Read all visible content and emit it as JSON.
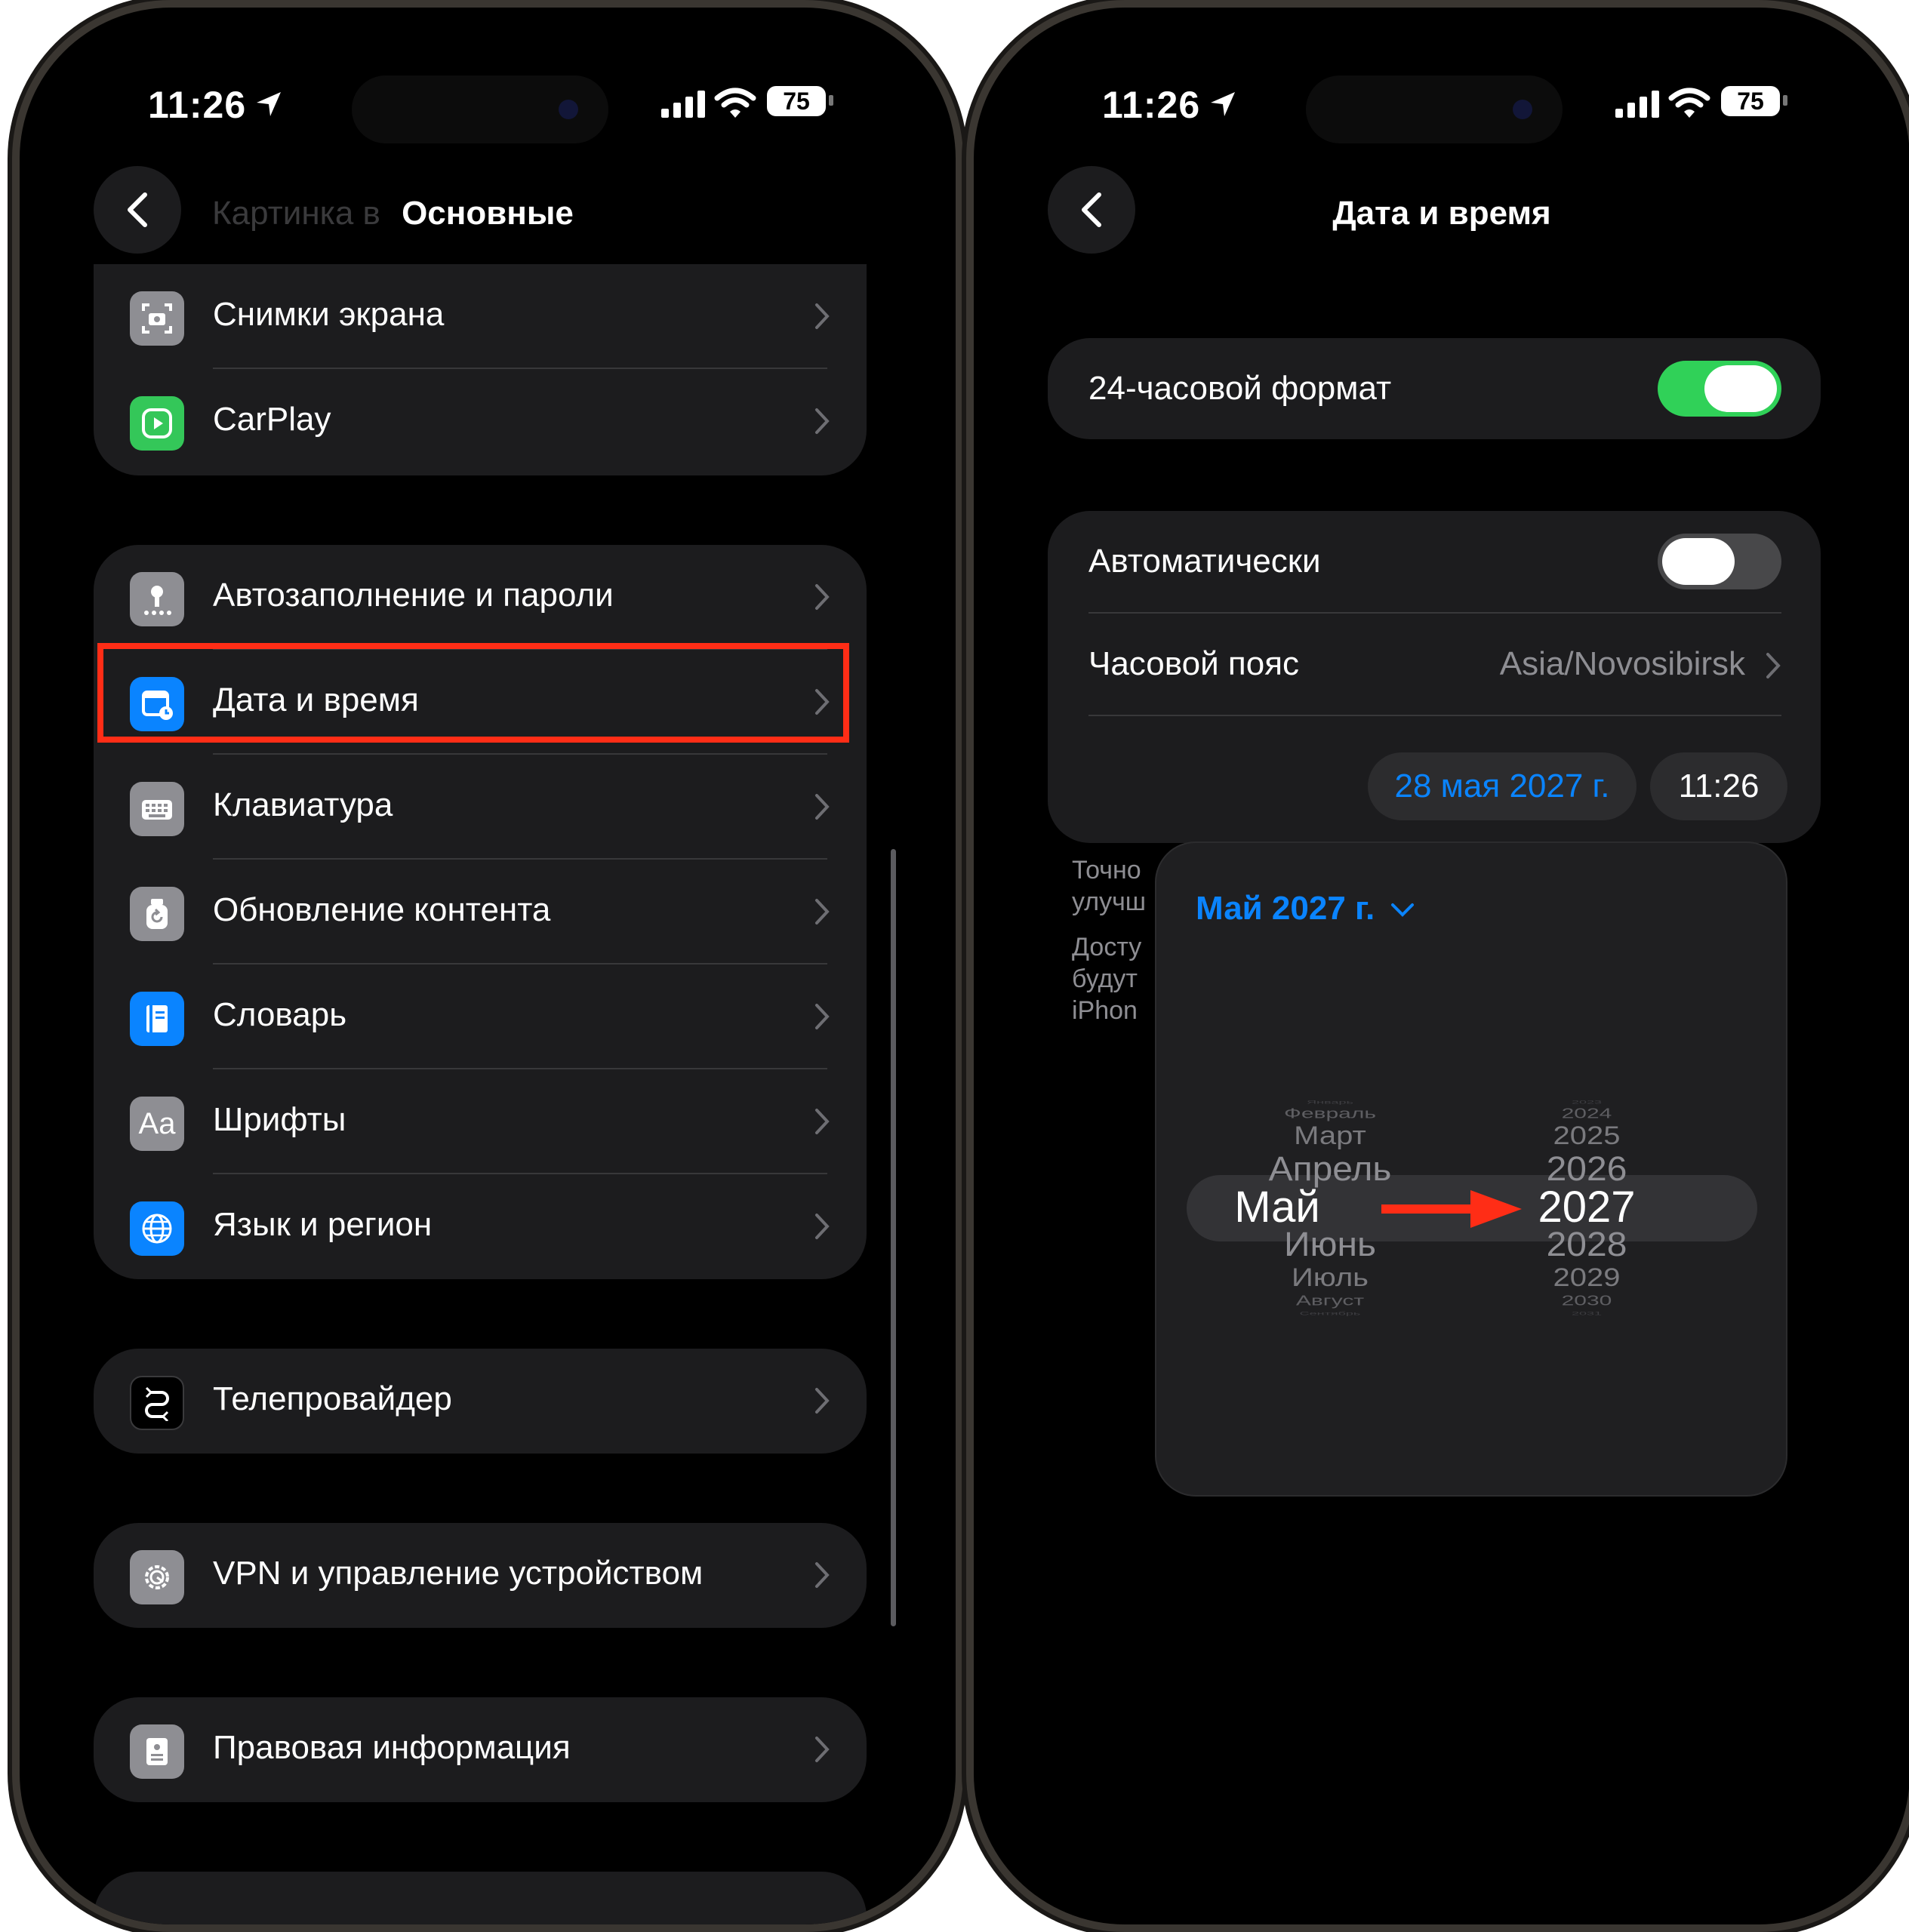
{
  "left_screen": {
    "status": {
      "time": "11:26",
      "battery": "75"
    },
    "nav": {
      "title": "Основные",
      "ghost_label": "Картинка в"
    },
    "groups": [
      {
        "items": [
          {
            "label": "Снимки экрана",
            "icon": "screenshot-icon"
          },
          {
            "label": "CarPlay",
            "icon": "carplay-icon"
          }
        ]
      },
      {
        "items": [
          {
            "label": "Автозаполнение и пароли",
            "icon": "key-icon"
          },
          {
            "label": "Дата и время",
            "icon": "calendar-clock-icon"
          },
          {
            "label": "Клавиатура",
            "icon": "keyboard-icon"
          },
          {
            "label": "Обновление контента",
            "icon": "refresh-icon"
          },
          {
            "label": "Словарь",
            "icon": "dictionary-icon"
          },
          {
            "label": "Шрифты",
            "icon": "fonts-icon",
            "glyph": "Aa"
          },
          {
            "label": "Язык и регион",
            "icon": "globe-icon"
          }
        ]
      },
      {
        "items": [
          {
            "label": "Телепровайдер",
            "icon": "tv-provider-icon"
          }
        ]
      },
      {
        "items": [
          {
            "label": "VPN и управление устройством",
            "icon": "gear-icon"
          }
        ]
      },
      {
        "items": [
          {
            "label": "Правовая информация",
            "icon": "legal-icon"
          }
        ]
      }
    ]
  },
  "right_screen": {
    "status": {
      "time": "11:26",
      "battery": "75"
    },
    "nav": {
      "title": "Дата и время"
    },
    "format24": {
      "label": "24-часовой формат",
      "on": true
    },
    "auto": {
      "label": "Автоматически",
      "on": false
    },
    "timezone": {
      "label": "Часовой пояс",
      "value": "Asia/Novosibirsk"
    },
    "date_pill": "28 мая 2027 г.",
    "time_pill": "11:26",
    "footnote_fragments": [
      "Точно",
      "улучш",
      "Досту",
      "будут",
      "iPhon"
    ],
    "picker": {
      "header": "Май 2027 г.",
      "months": [
        "Январь",
        "Февраль",
        "Март",
        "Апрель",
        "Май",
        "Июнь",
        "Июль",
        "Август",
        "Сентябрь"
      ],
      "years": [
        "2023",
        "2024",
        "2025",
        "2026",
        "2027",
        "2028",
        "2029",
        "2030",
        "2031"
      ],
      "selected_month": "Май",
      "selected_year": "2027"
    }
  },
  "colors": {
    "accent": "#0a84ff",
    "toggle_on": "#30d158",
    "highlight": "#ff2d16",
    "cell": "#1c1c1e"
  }
}
